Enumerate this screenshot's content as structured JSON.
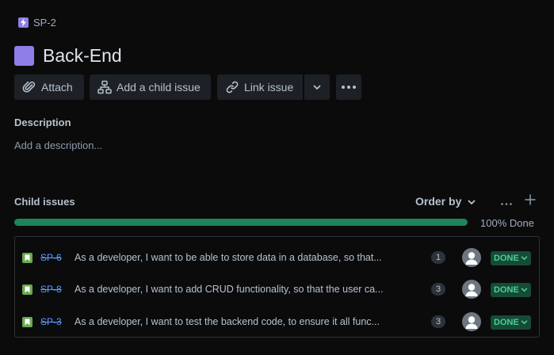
{
  "breadcrumb": {
    "key": "SP-2",
    "icon": "epic-lightning-icon"
  },
  "issue": {
    "title": "Back-End",
    "color": "#8f7ee7"
  },
  "toolbar": {
    "attach_label": "Attach",
    "add_child_label": "Add a child issue",
    "link_issue_label": "Link issue"
  },
  "description": {
    "heading": "Description",
    "placeholder": "Add a description..."
  },
  "child_issues": {
    "heading": "Child issues",
    "order_by_label": "Order by",
    "progress_percent": 100,
    "progress_label": "100% Done",
    "items": [
      {
        "key": "SP-6",
        "summary": "As a developer, I want to be able to store data in a database, so that...",
        "points": "1",
        "status": "DONE"
      },
      {
        "key": "SP-8",
        "summary": "As a developer, I want to add CRUD functionality, so that the user ca...",
        "points": "3",
        "status": "DONE"
      },
      {
        "key": "SP-3",
        "summary": "As a developer, I want to test the backend code, to ensure it all func...",
        "points": "3",
        "status": "DONE"
      }
    ]
  },
  "colors": {
    "background": "#0b0b0c",
    "progress": "#1f845a",
    "status_done_bg": "#164b35",
    "status_done_text": "#4bce97",
    "link": "#579dff",
    "story": "#6aa84f"
  }
}
